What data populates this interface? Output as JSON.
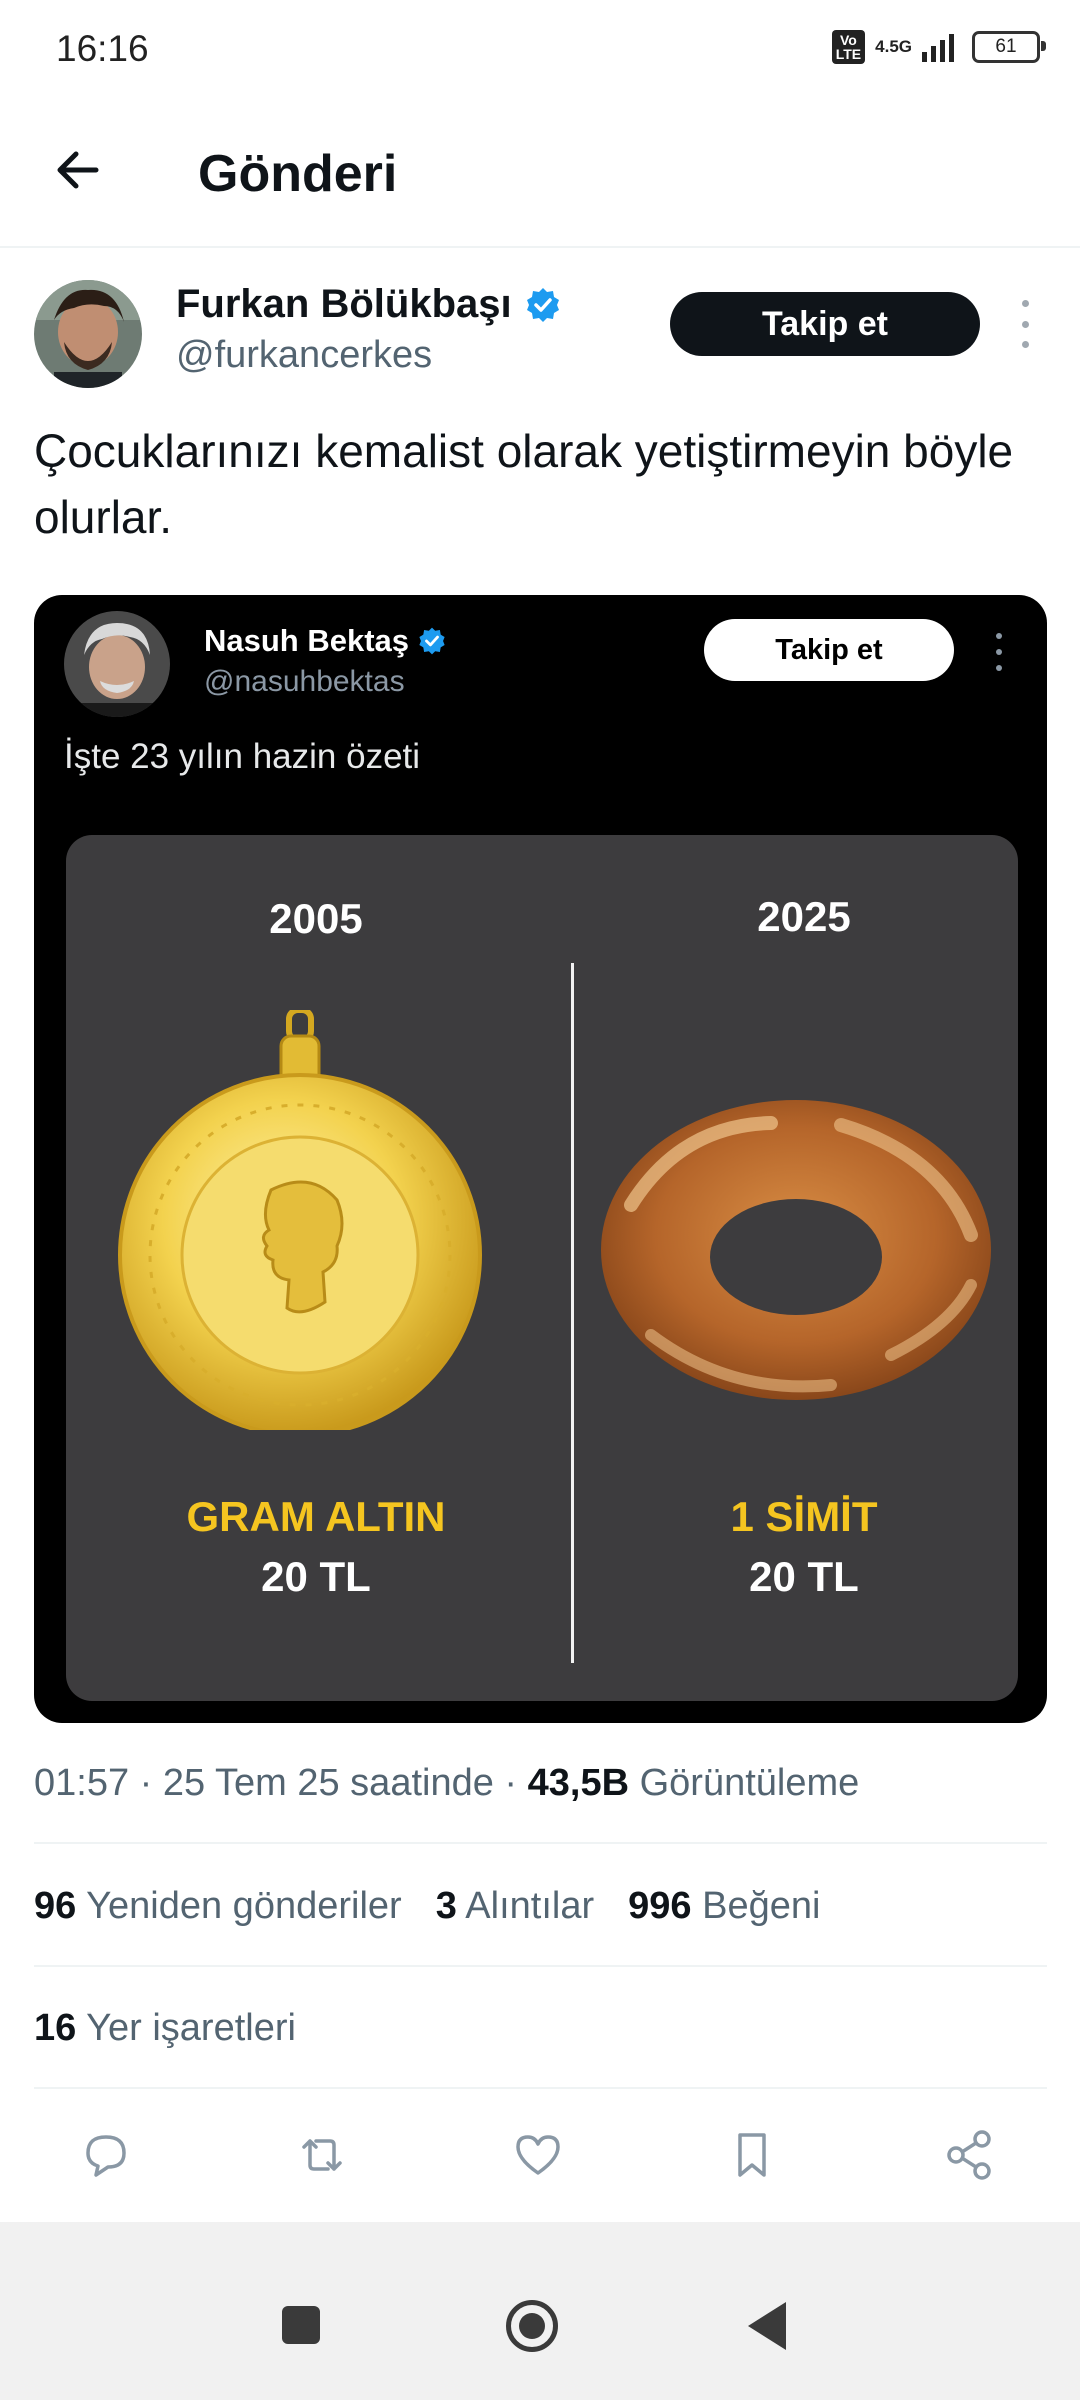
{
  "status_bar": {
    "time": "16:16",
    "volte": "Vo LTE",
    "network": "4.5G",
    "battery": "61"
  },
  "header": {
    "title": "Gönderi",
    "back_icon": "arrow-left-icon"
  },
  "post": {
    "author_name": "Furkan Bölükbaşı",
    "author_handle": "@furkancerkes",
    "follow_label": "Takip et",
    "text": "Çocuklarınızı kemalist olarak yetiştirmeyin böyle olurlar.",
    "verified_color": "#1d9bf0"
  },
  "quoted": {
    "author_name": "Nasuh Bektaş",
    "author_handle": "@nasuhbektas",
    "follow_label": "Takip et",
    "text": "İşte 23 yılın hazin özeti",
    "image": {
      "left_year": "2005",
      "right_year": "2025",
      "left_caption": "GRAM ALTIN",
      "left_price": "20 TL",
      "right_caption": "1 SİMİT",
      "right_price": "20 TL",
      "left_item": "gold-coin",
      "right_item": "simit"
    }
  },
  "meta": {
    "time": "01:57",
    "date": "25 Tem 25 saatinde",
    "views_count": "43,5B",
    "views_label": "Görüntüleme"
  },
  "stats": {
    "reposts_count": "96",
    "reposts_label": "Yeniden gönderiler",
    "quotes_count": "3",
    "quotes_label": "Alıntılar",
    "likes_count": "996",
    "likes_label": "Beğeni",
    "bookmarks_count": "16",
    "bookmarks_label": "Yer işaretleri"
  },
  "actions": [
    "reply-icon",
    "repost-icon",
    "like-icon",
    "bookmark-icon",
    "share-icon"
  ],
  "nav": [
    "recents-icon",
    "home-icon",
    "back-icon"
  ]
}
